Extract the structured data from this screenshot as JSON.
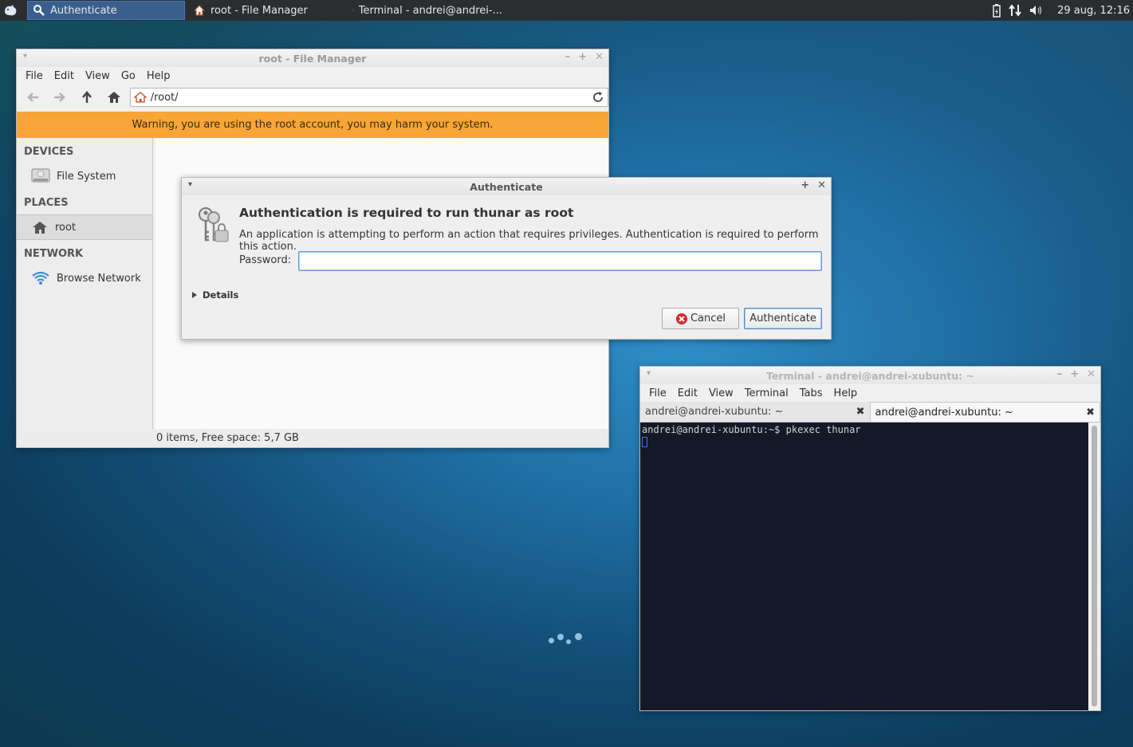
{
  "panel": {
    "tasks": [
      {
        "label": "Authenticate",
        "icon": "key-search-icon"
      },
      {
        "label": "root - File Manager",
        "icon": "home-icon"
      },
      {
        "label": "Terminal - andrei@andrei-...",
        "icon": "terminal-icon"
      }
    ],
    "clock": "29 aug, 12:16"
  },
  "file_manager": {
    "title": "root - File Manager",
    "menu": [
      "File",
      "Edit",
      "View",
      "Go",
      "Help"
    ],
    "location": "/root/",
    "warning": "Warning, you are using the root account, you may harm your system.",
    "sidebar": {
      "devices_header": "DEVICES",
      "file_system": "File System",
      "places_header": "PLACES",
      "root": "root",
      "network_header": "NETWORK",
      "browse_network": "Browse Network"
    },
    "status": "0 items, Free space: 5,7 GB"
  },
  "auth_dialog": {
    "title": "Authenticate",
    "heading": "Authentication is required to run thunar as root",
    "description": "An application is attempting to perform an action that requires privileges. Authentication is required to perform this action.",
    "password_label": "Password:",
    "password_value": "",
    "details_label": "Details",
    "cancel_label": "Cancel",
    "authenticate_label": "Authenticate"
  },
  "terminal": {
    "title": "Terminal - andrei@andrei-xubuntu: ~",
    "menu": [
      "File",
      "Edit",
      "View",
      "Terminal",
      "Tabs",
      "Help"
    ],
    "tabs": [
      "andrei@andrei-xubuntu: ~",
      "andrei@andrei-xubuntu: ~"
    ],
    "line": "andrei@andrei-xubuntu:~$ pkexec thunar"
  },
  "colors": {
    "warning_bg": "#f7a637",
    "panel_bg": "#2b2e31",
    "active_task": "#3a5f8e",
    "terminal_bg": "#131926"
  }
}
